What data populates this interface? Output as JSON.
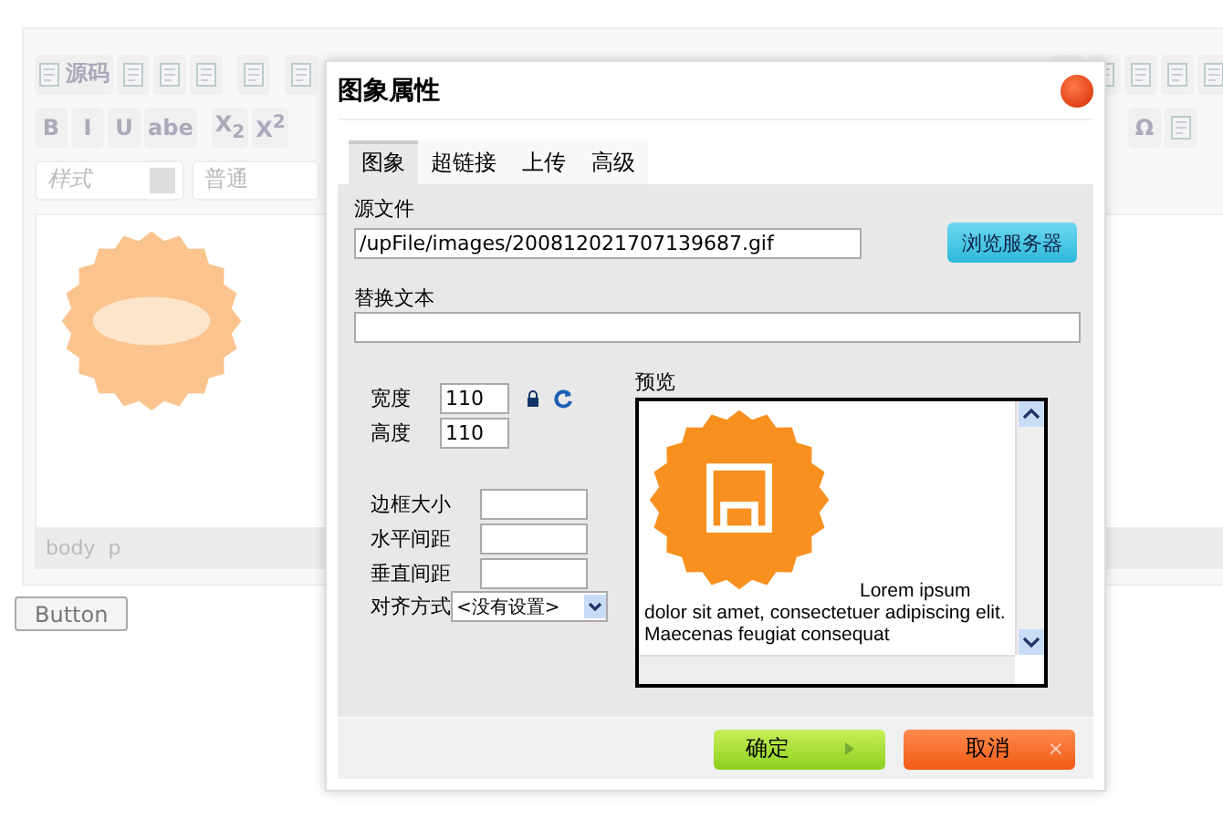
{
  "toolbar_rows": [
    [
      {
        "kind": "labeled",
        "label": "源码"
      },
      {
        "kind": "icon"
      },
      {
        "kind": "icon"
      },
      {
        "kind": "icon"
      },
      {
        "kind": "sep"
      },
      {
        "kind": "icon"
      },
      {
        "kind": "sep"
      },
      {
        "kind": "icon"
      }
    ],
    [
      {
        "kind": "text",
        "label": "B"
      },
      {
        "kind": "text",
        "label": "I"
      },
      {
        "kind": "text",
        "label": "U"
      },
      {
        "kind": "text",
        "label": "abe"
      },
      {
        "kind": "sep"
      },
      {
        "kind": "text",
        "label": "X$_{2}$"
      },
      {
        "kind": "text",
        "label": "X$^{2}$"
      }
    ]
  ],
  "toolbar_right": [
    [
      {
        "kind": "icon"
      },
      {
        "kind": "icon"
      },
      {
        "kind": "icon"
      },
      {
        "kind": "icon"
      },
      {
        "kind": "icon"
      }
    ],
    [
      {
        "kind": "text",
        "label": "Ω"
      },
      {
        "kind": "icon"
      }
    ]
  ],
  "style_select": {
    "placeholder": "样式"
  },
  "format_select": {
    "value": "普通"
  },
  "editor_content": {
    "kind": "picture"
  },
  "status_path": "body  p",
  "page_button": "Button",
  "dialog": {
    "title": "图象属性",
    "tabs": [
      {
        "label": "图象",
        "selected": true
      },
      {
        "label": "超链接",
        "selected": false
      },
      {
        "label": "上传",
        "selected": false
      },
      {
        "label": "高级",
        "selected": false
      }
    ],
    "source_label": "源文件",
    "source_value": "/upFile/images/200812021707139687.gif",
    "browse_button": "浏览服务器",
    "alt_label": "替换文本",
    "width_label": "宽度",
    "width_value": "110",
    "height_label": "高度",
    "height_value": "110",
    "border_label": "边框大小",
    "hspace_label": "水平间距",
    "vspace_label": "垂直间距",
    "align_label": "对齐方式",
    "align_value": "<没有设置>",
    "preview_label": "预览",
    "preview_text": "Lorem ipsum dolor sit amet, consectetuer adipiscing elit. Maecenas feugiat consequat",
    "ok_button": "确定",
    "cancel_button": "取消",
    "cancel_mark": "×"
  }
}
